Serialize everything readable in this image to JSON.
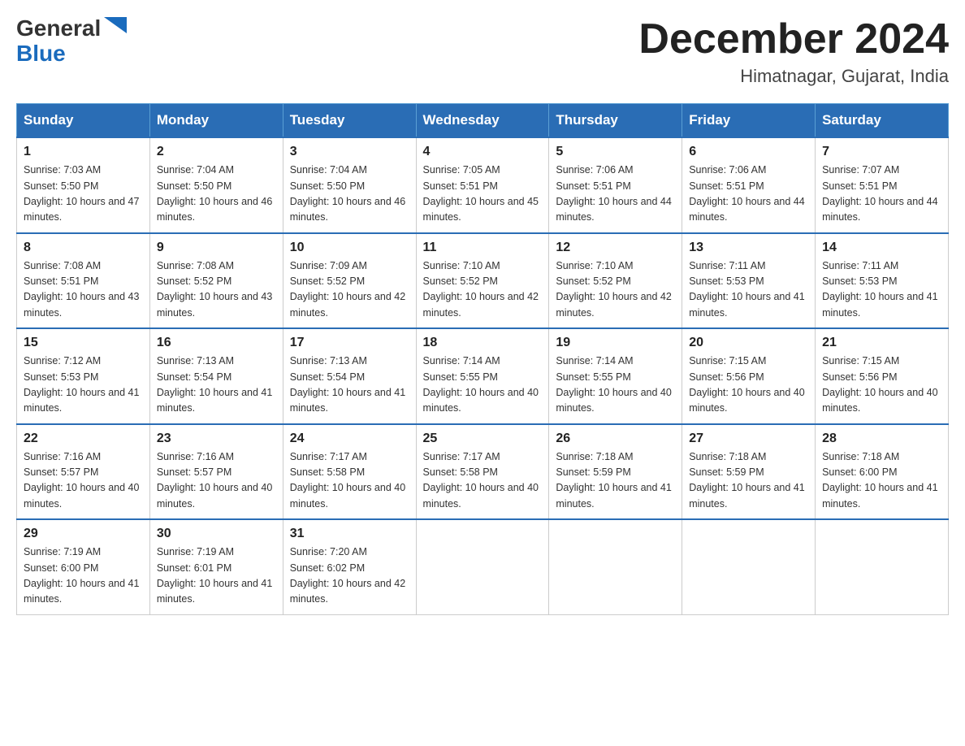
{
  "header": {
    "logo": {
      "general": "General",
      "blue": "Blue"
    },
    "title": "December 2024",
    "location": "Himatnagar, Gujarat, India"
  },
  "calendar": {
    "days_of_week": [
      "Sunday",
      "Monday",
      "Tuesday",
      "Wednesday",
      "Thursday",
      "Friday",
      "Saturday"
    ],
    "weeks": [
      [
        {
          "day": "1",
          "sunrise": "7:03 AM",
          "sunset": "5:50 PM",
          "daylight": "10 hours and 47 minutes."
        },
        {
          "day": "2",
          "sunrise": "7:04 AM",
          "sunset": "5:50 PM",
          "daylight": "10 hours and 46 minutes."
        },
        {
          "day": "3",
          "sunrise": "7:04 AM",
          "sunset": "5:50 PM",
          "daylight": "10 hours and 46 minutes."
        },
        {
          "day": "4",
          "sunrise": "7:05 AM",
          "sunset": "5:51 PM",
          "daylight": "10 hours and 45 minutes."
        },
        {
          "day": "5",
          "sunrise": "7:06 AM",
          "sunset": "5:51 PM",
          "daylight": "10 hours and 44 minutes."
        },
        {
          "day": "6",
          "sunrise": "7:06 AM",
          "sunset": "5:51 PM",
          "daylight": "10 hours and 44 minutes."
        },
        {
          "day": "7",
          "sunrise": "7:07 AM",
          "sunset": "5:51 PM",
          "daylight": "10 hours and 44 minutes."
        }
      ],
      [
        {
          "day": "8",
          "sunrise": "7:08 AM",
          "sunset": "5:51 PM",
          "daylight": "10 hours and 43 minutes."
        },
        {
          "day": "9",
          "sunrise": "7:08 AM",
          "sunset": "5:52 PM",
          "daylight": "10 hours and 43 minutes."
        },
        {
          "day": "10",
          "sunrise": "7:09 AM",
          "sunset": "5:52 PM",
          "daylight": "10 hours and 42 minutes."
        },
        {
          "day": "11",
          "sunrise": "7:10 AM",
          "sunset": "5:52 PM",
          "daylight": "10 hours and 42 minutes."
        },
        {
          "day": "12",
          "sunrise": "7:10 AM",
          "sunset": "5:52 PM",
          "daylight": "10 hours and 42 minutes."
        },
        {
          "day": "13",
          "sunrise": "7:11 AM",
          "sunset": "5:53 PM",
          "daylight": "10 hours and 41 minutes."
        },
        {
          "day": "14",
          "sunrise": "7:11 AM",
          "sunset": "5:53 PM",
          "daylight": "10 hours and 41 minutes."
        }
      ],
      [
        {
          "day": "15",
          "sunrise": "7:12 AM",
          "sunset": "5:53 PM",
          "daylight": "10 hours and 41 minutes."
        },
        {
          "day": "16",
          "sunrise": "7:13 AM",
          "sunset": "5:54 PM",
          "daylight": "10 hours and 41 minutes."
        },
        {
          "day": "17",
          "sunrise": "7:13 AM",
          "sunset": "5:54 PM",
          "daylight": "10 hours and 41 minutes."
        },
        {
          "day": "18",
          "sunrise": "7:14 AM",
          "sunset": "5:55 PM",
          "daylight": "10 hours and 40 minutes."
        },
        {
          "day": "19",
          "sunrise": "7:14 AM",
          "sunset": "5:55 PM",
          "daylight": "10 hours and 40 minutes."
        },
        {
          "day": "20",
          "sunrise": "7:15 AM",
          "sunset": "5:56 PM",
          "daylight": "10 hours and 40 minutes."
        },
        {
          "day": "21",
          "sunrise": "7:15 AM",
          "sunset": "5:56 PM",
          "daylight": "10 hours and 40 minutes."
        }
      ],
      [
        {
          "day": "22",
          "sunrise": "7:16 AM",
          "sunset": "5:57 PM",
          "daylight": "10 hours and 40 minutes."
        },
        {
          "day": "23",
          "sunrise": "7:16 AM",
          "sunset": "5:57 PM",
          "daylight": "10 hours and 40 minutes."
        },
        {
          "day": "24",
          "sunrise": "7:17 AM",
          "sunset": "5:58 PM",
          "daylight": "10 hours and 40 minutes."
        },
        {
          "day": "25",
          "sunrise": "7:17 AM",
          "sunset": "5:58 PM",
          "daylight": "10 hours and 40 minutes."
        },
        {
          "day": "26",
          "sunrise": "7:18 AM",
          "sunset": "5:59 PM",
          "daylight": "10 hours and 41 minutes."
        },
        {
          "day": "27",
          "sunrise": "7:18 AM",
          "sunset": "5:59 PM",
          "daylight": "10 hours and 41 minutes."
        },
        {
          "day": "28",
          "sunrise": "7:18 AM",
          "sunset": "6:00 PM",
          "daylight": "10 hours and 41 minutes."
        }
      ],
      [
        {
          "day": "29",
          "sunrise": "7:19 AM",
          "sunset": "6:00 PM",
          "daylight": "10 hours and 41 minutes."
        },
        {
          "day": "30",
          "sunrise": "7:19 AM",
          "sunset": "6:01 PM",
          "daylight": "10 hours and 41 minutes."
        },
        {
          "day": "31",
          "sunrise": "7:20 AM",
          "sunset": "6:02 PM",
          "daylight": "10 hours and 42 minutes."
        },
        null,
        null,
        null,
        null
      ]
    ]
  }
}
